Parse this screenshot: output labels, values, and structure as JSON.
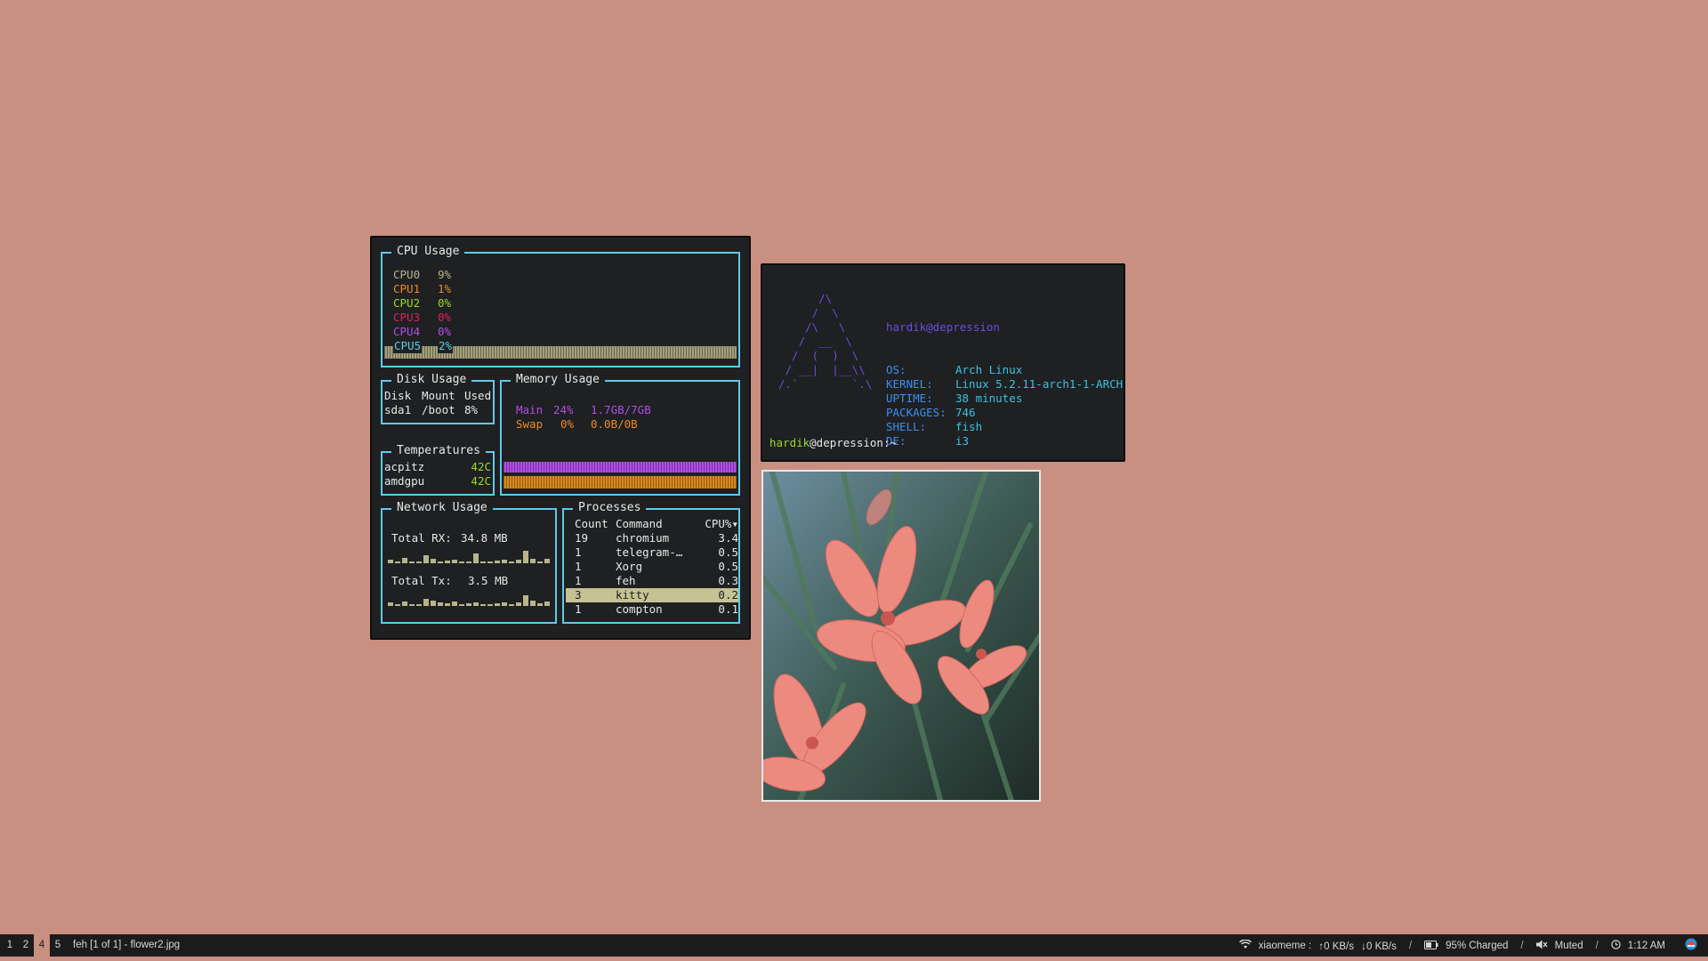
{
  "colors": {
    "desktop": "#c98f81",
    "border_cyan": "#5ecbe8",
    "window_bg": "#1e2022",
    "cpu0": "#b9b58a",
    "cpu1": "#f08a1e",
    "cpu2": "#9ad82a",
    "cpu3": "#e01e5a",
    "cpu4": "#b24ee8",
    "cpu5": "#5ecbe8",
    "main_mem": "#b24ee8",
    "swap_mem": "#f08a1e",
    "temp_value": "#9ad82a",
    "arch_blue": "#6b4de0",
    "prompt_green": "#9ad82a"
  },
  "gotop": {
    "cpu": {
      "title": "CPU Usage",
      "cores": [
        {
          "label": "CPU0",
          "value": "9%"
        },
        {
          "label": "CPU1",
          "value": "1%"
        },
        {
          "label": "CPU2",
          "value": "0%"
        },
        {
          "label": "CPU3",
          "value": "0%"
        },
        {
          "label": "CPU4",
          "value": "0%"
        },
        {
          "label": "CPU5",
          "value": "2%"
        }
      ]
    },
    "disk": {
      "title": "Disk Usage",
      "headers": [
        "Disk",
        "Mount",
        "Used"
      ],
      "rows": [
        [
          "sda1",
          "/boot",
          "8%"
        ]
      ]
    },
    "memory": {
      "title": "Memory Usage",
      "main": {
        "label": "Main",
        "percent": "24%",
        "amount": "1.7GB/7GB"
      },
      "swap": {
        "label": "Swap",
        "percent": "0%",
        "amount": "0.0B/0B"
      }
    },
    "temps": {
      "title": "Temperatures",
      "rows": [
        {
          "name": "acpitz",
          "value": "42C"
        },
        {
          "name": "amdgpu",
          "value": "42C"
        }
      ]
    },
    "network": {
      "title": "Network Usage",
      "rx_label": "Total RX:",
      "rx_value": "34.8 MB",
      "tx_label": "Total Tx:",
      "tx_value": "3.5 MB",
      "rx_spark": [
        0.2,
        0.1,
        0.35,
        0.05,
        0.1,
        0.5,
        0.3,
        0.1,
        0.15,
        0.2,
        0.05,
        0.1,
        0.6,
        0.1,
        0.05,
        0.15,
        0.2,
        0.1,
        0.2,
        0.75,
        0.3,
        0.1,
        0.25
      ],
      "tx_spark": [
        0.2,
        0.1,
        0.3,
        0.1,
        0.1,
        0.45,
        0.35,
        0.2,
        0.15,
        0.3,
        0.1,
        0.15,
        0.2,
        0.1,
        0.05,
        0.15,
        0.2,
        0.1,
        0.2,
        0.65,
        0.35,
        0.15,
        0.25
      ]
    },
    "processes": {
      "title": "Processes",
      "headers": [
        "Count",
        "Command",
        "CPU%▾"
      ],
      "rows": [
        [
          "19",
          "chromium",
          "3.4"
        ],
        [
          "1",
          "telegram-…",
          "0.5"
        ],
        [
          "1",
          "Xorg",
          "0.5"
        ],
        [
          "1",
          "feh",
          "0.3"
        ],
        [
          "3",
          "kitty",
          "0.2"
        ],
        [
          "1",
          "compton",
          "0.1"
        ]
      ],
      "selected_index": 4
    }
  },
  "terminal": {
    "ascii_art": "      /\\\n     /  \\\n    /\\   \\\n   /  __  \\\n  /  (  )  \\\n / __|  |__\\\\\n/.`        `.\\",
    "user": "hardik",
    "at_host": "@depression",
    "info": [
      {
        "key": "OS:",
        "value": "Arch Linux"
      },
      {
        "key": "KERNEL:",
        "value": "Linux 5.2.11-arch1-1-ARCH"
      },
      {
        "key": "UPTIME:",
        "value": "38 minutes"
      },
      {
        "key": "PACKAGES:",
        "value": "746"
      },
      {
        "key": "SHELL:",
        "value": "fish"
      },
      {
        "key": "DE:",
        "value": "i3"
      }
    ],
    "prompt_user": "hardik",
    "prompt_host": "@depression:~",
    "prompt_arrow": "▸"
  },
  "taskbar": {
    "workspaces": [
      "1",
      "2",
      "4",
      "5"
    ],
    "active_workspace": "4",
    "window_title": "feh [1 of 1] - flower2.jpg",
    "wifi_name": "xiaomeme :",
    "up_speed": "0 KB/s",
    "down_speed": "0 KB/s",
    "sep": "/",
    "battery": "95% Charged",
    "volume": "Muted",
    "time": "1:12 AM",
    "icons": {
      "wifi": "wifi-icon",
      "battery": "battery-icon",
      "volume": "volume-muted-icon",
      "clock": "clock-icon",
      "tray": "tray-app-icon"
    }
  }
}
